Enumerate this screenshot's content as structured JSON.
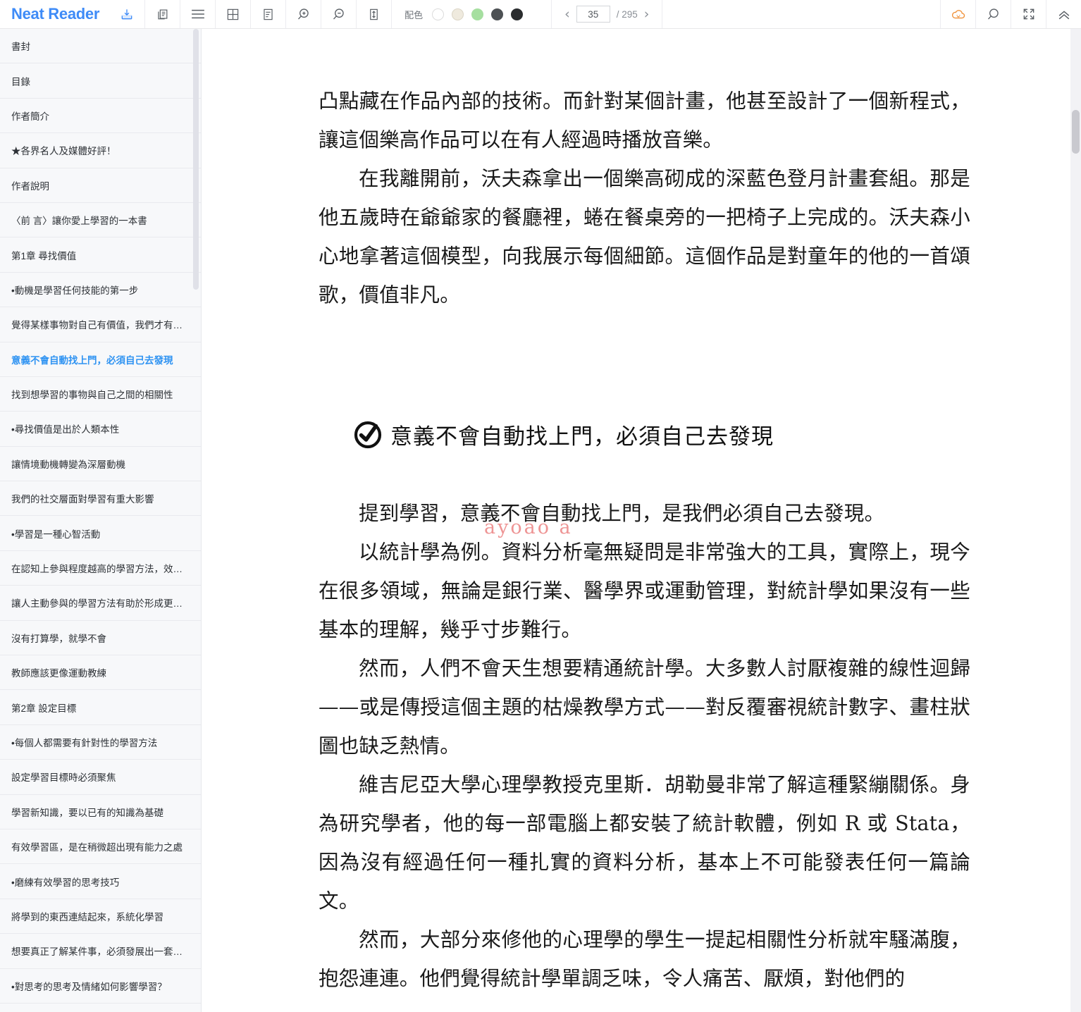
{
  "app": {
    "brand": "Neat Reader"
  },
  "toolbar": {
    "icons": [
      {
        "name": "save-to-library-icon",
        "glyph": "save"
      },
      {
        "name": "copy-icon",
        "glyph": "copy"
      },
      {
        "name": "menu-lines-icon",
        "glyph": "menu"
      },
      {
        "name": "grid-layout-icon",
        "glyph": "grid"
      },
      {
        "name": "note-icon",
        "glyph": "note"
      },
      {
        "name": "zoom-in-icon",
        "glyph": "zoomin"
      },
      {
        "name": "zoom-out-icon",
        "glyph": "zoomout"
      },
      {
        "name": "line-height-icon",
        "glyph": "lineheight"
      }
    ],
    "color_scheme": {
      "label": "配色",
      "swatches": [
        {
          "name": "swatch-white",
          "color": "#ffffff",
          "border": "#dddddd",
          "selected": false
        },
        {
          "name": "swatch-sepia",
          "color": "#efeade",
          "border": "#dcd6c7",
          "selected": false
        },
        {
          "name": "swatch-green",
          "color": "#a6dfa0",
          "border": "#a6dfa0",
          "selected": false
        },
        {
          "name": "swatch-gray",
          "color": "#4d5154",
          "border": "#4d5154",
          "selected": false
        },
        {
          "name": "swatch-black",
          "color": "#2b2d2f",
          "border": "#2b2d2f",
          "selected": false
        }
      ]
    },
    "pagination": {
      "prev": "‹",
      "next": "›",
      "current_page": "35",
      "total": "/ 295"
    },
    "right_icons": [
      {
        "name": "cloud-sync-icon",
        "glyph": "cloud",
        "color": "#f0923a"
      },
      {
        "name": "search-icon",
        "glyph": "search",
        "color": "#5b6066"
      },
      {
        "name": "fullscreen-icon",
        "glyph": "fullscreen",
        "color": "#5b6066"
      },
      {
        "name": "collapse-toolbar-icon",
        "glyph": "chevrons-up",
        "color": "#5b6066"
      }
    ]
  },
  "sidebar": {
    "items": [
      {
        "label": "書封",
        "active": false
      },
      {
        "label": "目錄",
        "active": false
      },
      {
        "label": "作者簡介",
        "active": false
      },
      {
        "label": "★各界名人及媒體好評！",
        "active": false
      },
      {
        "label": "作者說明",
        "active": false
      },
      {
        "label": "〈前 言〉讓你愛上學習的一本書",
        "active": false
      },
      {
        "label": "第1章 尋找價值",
        "active": false
      },
      {
        "label": "•動機是學習任何技能的第一步",
        "active": false
      },
      {
        "label": "覺得某樣事物對自己有價值，我們才有…",
        "active": false
      },
      {
        "label": "意義不會自動找上門，必須自己去發現",
        "active": true
      },
      {
        "label": "找到想學習的事物與自己之間的相關性",
        "active": false
      },
      {
        "label": "•尋找價值是出於人類本性",
        "active": false
      },
      {
        "label": "讓情境動機轉變為深層動機",
        "active": false
      },
      {
        "label": "我們的社交層面對學習有重大影響",
        "active": false
      },
      {
        "label": "•學習是一種心智活動",
        "active": false
      },
      {
        "label": "在認知上參與程度越高的學習方法，效…",
        "active": false
      },
      {
        "label": "讓人主動參與的學習方法有助於形成更…",
        "active": false
      },
      {
        "label": "沒有打算學，就學不會",
        "active": false
      },
      {
        "label": "教師應該更像運動教練",
        "active": false
      },
      {
        "label": "第2章 設定目標",
        "active": false
      },
      {
        "label": "•每個人都需要有針對性的學習方法",
        "active": false
      },
      {
        "label": "設定學習目標時必須聚焦",
        "active": false
      },
      {
        "label": "學習新知識，要以已有的知識為基礎",
        "active": false
      },
      {
        "label": "有效學習區，是在稍微超出現有能力之處",
        "active": false
      },
      {
        "label": "•磨練有效學習的思考技巧",
        "active": false
      },
      {
        "label": "將學到的東西連結起來，系統化學習",
        "active": false
      },
      {
        "label": "想要真正了解某件事，必須發展出一套…",
        "active": false
      },
      {
        "label": "•對思考的思考及情緒如何影響學習？",
        "active": false
      }
    ]
  },
  "content": {
    "paragraphs": [
      "凸點藏在作品內部的技術。而針對某個計畫，他甚至設計了一個新程式，讓這個樂高作品可以在有人經過時播放音樂。",
      "在我離開前，沃夫森拿出一個樂高砌成的深藍色登月計畫套組。那是他五歲時在爺爺家的餐廳裡，蜷在餐桌旁的一把椅子上完成的。沃夫森小心地拿著這個模型，向我展示每個細節。這個作品是對童年的他的一首頌歌，價值非凡。"
    ],
    "section_heading": "意義不會自動找上門，必須自己去發現",
    "after_heading_paragraphs": [
      "提到學習，意義不會自動找上門，是我們必須自己去發現。",
      "以統計學為例。資料分析毫無疑問是非常強大的工具，實際上，現今在很多領域，無論是銀行業、醫學界或運動管理，對統計學如果沒有一些基本的理解，幾乎寸步難行。",
      "然而，人們不會天生想要精通統計學。大多數人討厭複雜的線性迴歸——或是傳授這個主題的枯燥教學方式——對反覆審視統計數字、畫柱狀圖也缺乏熱情。",
      "維吉尼亞大學心理學教授克里斯．胡勒曼非常了解這種緊繃關係。身為研究學者，他的每一部電腦上都安裝了統計軟體，例如 R 或 Stata，因為沒有經過任何一種扎實的資料分析，基本上不可能發表任何一篇論文。",
      "然而，大部分來修他的心理學的學生一提起相關性分析就牢騷滿腹，抱怨連連。他們覺得統計學單調乏味，令人痛苦、厭煩，對他們的"
    ],
    "watermark": "ayoao a"
  }
}
